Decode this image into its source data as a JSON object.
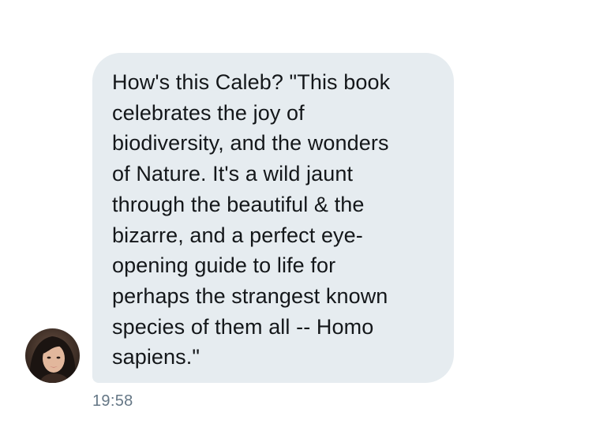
{
  "message": {
    "text": "How's this Caleb? \"This book\ncelebrates the joy of\nbiodiversity, and the wonders\nof Nature. It's a wild jaunt\nthrough the beautiful & the\nbizarre, and a perfect eye-\nopening guide to life for\nperhaps the strangest known\nspecies of them all -- Homo\nsapiens.\"",
    "timestamp": "19:58"
  },
  "colors": {
    "bubble_background": "#e6ecf0",
    "text": "#14171a",
    "timestamp": "#657786"
  },
  "sender": {
    "avatar_icon": "user-avatar-photo"
  }
}
